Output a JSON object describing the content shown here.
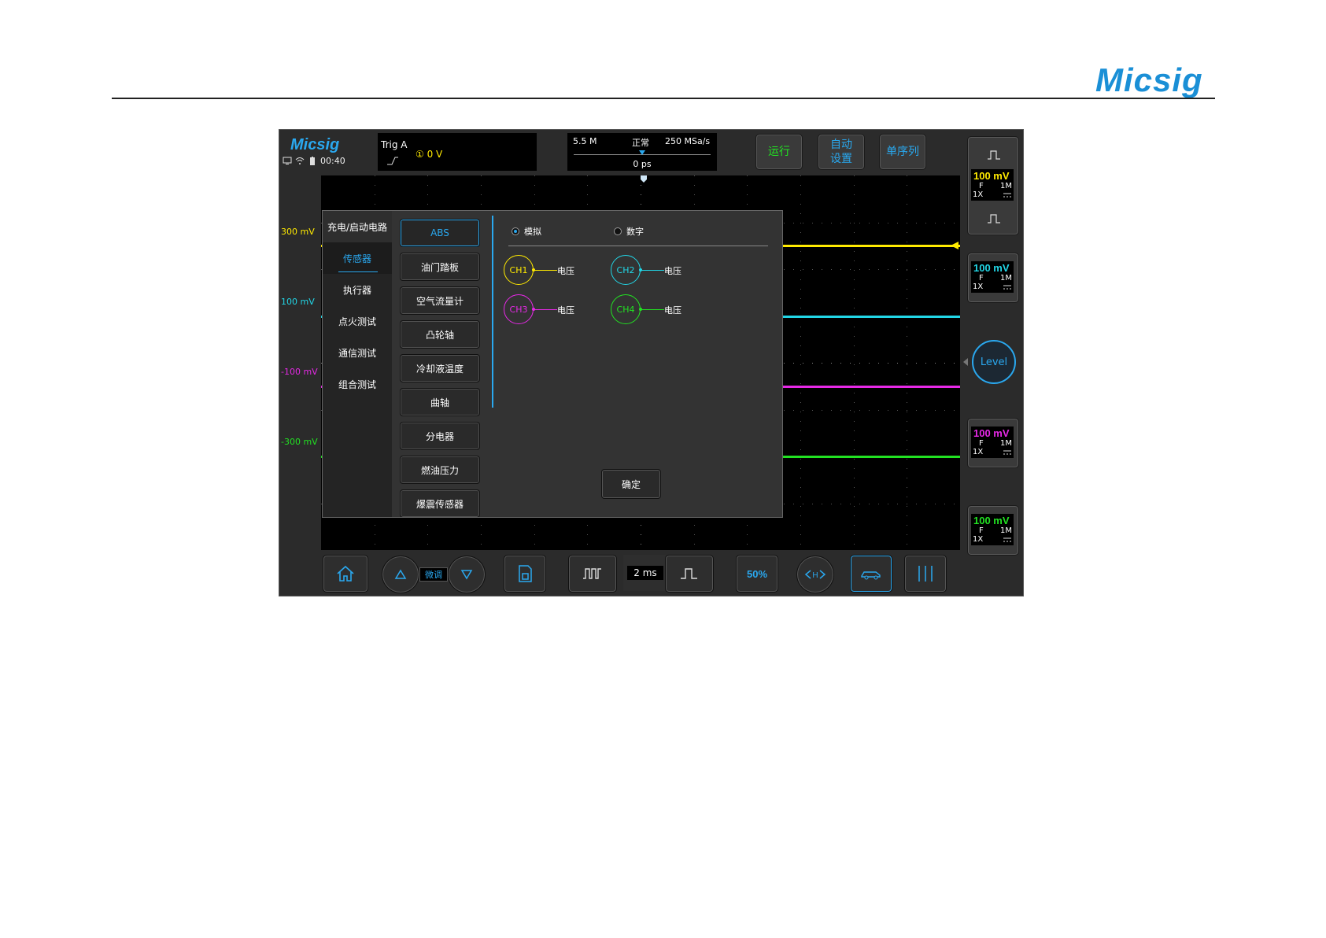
{
  "page": {
    "brand": "Micsig"
  },
  "device": {
    "logo": "Micsig",
    "clock": "00:40",
    "trigger": {
      "label": "Trig  A",
      "level": "① 0  V"
    },
    "acquisition": {
      "memory_depth": "5.5 M",
      "mode": "正常",
      "sample_rate": "250 MSa/s",
      "delay": "0 ps"
    },
    "top_buttons": {
      "run": "运行",
      "auto_line1": "自动",
      "auto_line2": "设置",
      "single": "单序列"
    },
    "volt_labels": [
      {
        "text": "300 mV",
        "color": "#ffea00"
      },
      {
        "text": "100 mV",
        "color": "#22d6e6"
      },
      {
        "text": "-100 mV",
        "color": "#e629e6"
      },
      {
        "text": "-300 mV",
        "color": "#22e222"
      }
    ],
    "channels": [
      {
        "id": "CH1",
        "volt": "100 mV",
        "coupling": "F",
        "impedance": "1M",
        "probe": "1X",
        "color": "#ffea00"
      },
      {
        "id": "CH2",
        "volt": "100 mV",
        "coupling": "F",
        "impedance": "1M",
        "probe": "1X",
        "color": "#22d6e6"
      },
      {
        "id": "CH3",
        "volt": "100 mV",
        "coupling": "F",
        "impedance": "1M",
        "probe": "1X",
        "color": "#e629e6"
      },
      {
        "id": "CH4",
        "volt": "100 mV",
        "coupling": "F",
        "impedance": "1M",
        "probe": "1X",
        "color": "#22e222"
      }
    ],
    "level_button": "Level",
    "bottom": {
      "fine": "微调",
      "timebase": "2 ms",
      "icons": [
        "home-icon",
        "up-triangle-icon",
        "down-triangle-icon",
        "save-icon",
        "wide-pulse-icon",
        "narrow-pulse-icon",
        "fifty-percent-icon",
        "horizontal-position-icon",
        "car-icon",
        "cursor-lines-icon"
      ],
      "fifty": "50%"
    }
  },
  "dialog": {
    "categories": [
      {
        "label": "充电/启动电路",
        "selected": false
      },
      {
        "label": "传感器",
        "selected": true
      },
      {
        "label": "执行器",
        "selected": false
      },
      {
        "label": "点火测试",
        "selected": false
      },
      {
        "label": "通信测试",
        "selected": false
      },
      {
        "label": "组合测试",
        "selected": false
      }
    ],
    "sensors": [
      {
        "label": "ABS",
        "selected": true
      },
      {
        "label": "油门踏板",
        "selected": false
      },
      {
        "label": "空气流量计",
        "selected": false
      },
      {
        "label": "凸轮轴",
        "selected": false
      },
      {
        "label": "冷却液温度",
        "selected": false
      },
      {
        "label": "曲轴",
        "selected": false
      },
      {
        "label": "分电器",
        "selected": false
      },
      {
        "label": "燃油压力",
        "selected": false
      },
      {
        "label": "爆震传感器",
        "selected": false
      }
    ],
    "mode": {
      "analog": "模拟",
      "digital": "数字",
      "selected": "analog"
    },
    "channel_map": [
      {
        "ch": "CH1",
        "signal": "电压",
        "color": "#ffea00"
      },
      {
        "ch": "CH2",
        "signal": "电压",
        "color": "#22d6e6"
      },
      {
        "ch": "CH3",
        "signal": "电压",
        "color": "#e629e6"
      },
      {
        "ch": "CH4",
        "signal": "电压",
        "color": "#22e222"
      }
    ],
    "confirm": "确定"
  }
}
